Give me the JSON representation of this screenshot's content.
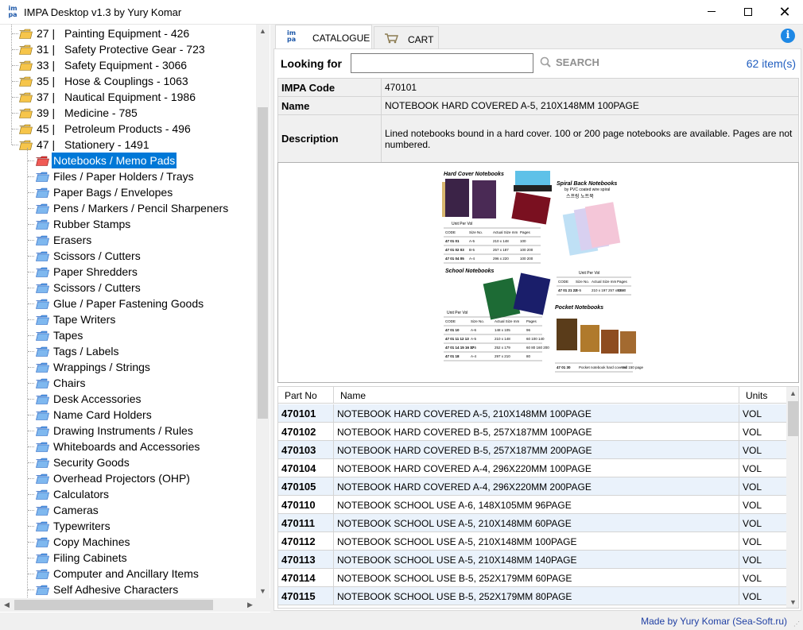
{
  "window": {
    "title": "IMPA Desktop v1.3 by Yury Komar",
    "app_icon_text": "im pa"
  },
  "tree": {
    "parents": [
      {
        "code": "27 |",
        "label": "Painting Equipment - 426"
      },
      {
        "code": "31 |",
        "label": "Safety Protective Gear - 723"
      },
      {
        "code": "33 |",
        "label": "Safety Equipment - 3066"
      },
      {
        "code": "35 |",
        "label": "Hose & Couplings - 1063"
      },
      {
        "code": "37 |",
        "label": "Nautical Equipment - 1986"
      },
      {
        "code": "39 |",
        "label": "Medicine - 785"
      },
      {
        "code": "45 |",
        "label": "Petroleum Products  - 496"
      },
      {
        "code": "47 |",
        "label": "Stationery - 1491"
      }
    ],
    "children": [
      {
        "label": "Notebooks / Memo Pads",
        "selected": true
      },
      {
        "label": "Files / Paper Holders / Trays"
      },
      {
        "label": "Paper Bags / Envelopes"
      },
      {
        "label": "Pens / Markers / Pencil Sharpeners"
      },
      {
        "label": "Rubber Stamps"
      },
      {
        "label": "Erasers"
      },
      {
        "label": "Scissors / Cutters"
      },
      {
        "label": "Paper Shredders"
      },
      {
        "label": "Scissors / Cutters"
      },
      {
        "label": "Glue / Paper Fastening Goods"
      },
      {
        "label": "Tape Writers"
      },
      {
        "label": "Tapes"
      },
      {
        "label": "Tags / Labels"
      },
      {
        "label": "Wrappings / Strings"
      },
      {
        "label": "Chairs"
      },
      {
        "label": "Desk Accessories"
      },
      {
        "label": "Name Card Holders"
      },
      {
        "label": "Drawing Instruments / Rules"
      },
      {
        "label": "Whiteboards and Accessories"
      },
      {
        "label": "Security Goods"
      },
      {
        "label": "Overhead Projectors (OHP)"
      },
      {
        "label": "Calculators"
      },
      {
        "label": "Cameras"
      },
      {
        "label": "Typewriters"
      },
      {
        "label": "Copy Machines"
      },
      {
        "label": "Filing Cabinets"
      },
      {
        "label": "Computer and Ancillary Items"
      },
      {
        "label": "Self Adhesive Characters"
      }
    ]
  },
  "tabs": {
    "catalogue": "CATALOGUE",
    "cart": "CART"
  },
  "search": {
    "label": "Looking for",
    "value": "",
    "button": "SEARCH",
    "count": "62 item(s)"
  },
  "details": {
    "code_label": "IMPA Code",
    "code_value": "470101",
    "name_label": "Name",
    "name_value": "NOTEBOOK HARD COVERED A-5, 210X148MM 100PAGE",
    "desc_label": "Description",
    "desc_value": "Lined notebooks bound in a hard cover. 100 or 200 page notebooks are available. Pages are not numbered."
  },
  "catalog_image": {
    "hard_cover_title": "Hard Cover Notebooks",
    "spiral_title": "Spiral Back Notebooks",
    "spiral_sub": "by PVC  coated wire spiral",
    "spiral_korean": "스프링 노트북",
    "school_title": "School Notebooks",
    "pocket_title": "Pocket Notebooks",
    "unit_per_vol": "Unit Per Vol",
    "hard_table": {
      "headers": [
        "CODE",
        "Size No.",
        "Actual Size mm",
        "Pages"
      ],
      "rows": [
        [
          "47 01 01",
          "A-5",
          "210 x 148",
          "100"
        ],
        [
          "47 01 02 03",
          "B-5",
          "257 x 187",
          "100 200"
        ],
        [
          "47 01 04 05",
          "A-4",
          "296 x 220",
          "100 200"
        ]
      ]
    },
    "spiral_table": {
      "headers": [
        "CODE",
        "Size No.",
        "Actual Size mm",
        "Pages"
      ],
      "rows": [
        [
          "47 01 21 22",
          "B-5",
          "210 x 197 257 x 182",
          "80 80"
        ]
      ]
    },
    "school_table": {
      "headers": [
        "CODE",
        "Size No.",
        "Actual Size mm",
        "Pages"
      ],
      "rows": [
        [
          "47 01 10",
          "A-6",
          "148 x 105",
          "96"
        ],
        [
          "47 01 11 12 13",
          "A-5",
          "210 x 148",
          "60 100 140"
        ],
        [
          "47 01 14 15 16 17",
          "B-5",
          "252 x 179",
          "60 80 160 200"
        ],
        [
          "47 01 18",
          "A-4",
          "297 x 210",
          "80"
        ]
      ]
    },
    "pocket_table": {
      "rows": [
        [
          "47 01 30",
          "Pocket notebook hard covered 150 page",
          "Vol"
        ]
      ]
    }
  },
  "grid": {
    "headers": {
      "part": "Part No",
      "name": "Name",
      "units": "Units"
    },
    "rows": [
      {
        "part": "470101",
        "name": "NOTEBOOK HARD COVERED A-5, 210X148MM 100PAGE",
        "units": "VOL"
      },
      {
        "part": "470102",
        "name": "NOTEBOOK HARD COVERED B-5, 257X187MM 100PAGE",
        "units": "VOL"
      },
      {
        "part": "470103",
        "name": "NOTEBOOK HARD COVERED B-5, 257X187MM 200PAGE",
        "units": "VOL"
      },
      {
        "part": "470104",
        "name": "NOTEBOOK HARD COVERED A-4, 296X220MM 100PAGE",
        "units": "VOL"
      },
      {
        "part": "470105",
        "name": "NOTEBOOK HARD COVERED A-4, 296X220MM 200PAGE",
        "units": "VOL"
      },
      {
        "part": "470110",
        "name": "NOTEBOOK SCHOOL USE A-6, 148X105MM 96PAGE",
        "units": "VOL"
      },
      {
        "part": "470111",
        "name": "NOTEBOOK SCHOOL USE A-5, 210X148MM 60PAGE",
        "units": "VOL"
      },
      {
        "part": "470112",
        "name": "NOTEBOOK SCHOOL USE A-5, 210X148MM 100PAGE",
        "units": "VOL"
      },
      {
        "part": "470113",
        "name": "NOTEBOOK SCHOOL USE A-5, 210X148MM 140PAGE",
        "units": "VOL"
      },
      {
        "part": "470114",
        "name": "NOTEBOOK SCHOOL USE B-5, 252X179MM 60PAGE",
        "units": "VOL"
      },
      {
        "part": "470115",
        "name": "NOTEBOOK SCHOOL USE B-5, 252X179MM 80PAGE",
        "units": "VOL"
      }
    ]
  },
  "status": {
    "credit": "Made by Yury Komar (Sea-Soft.ru)"
  },
  "colors": {
    "selection": "#0078d7",
    "folder_yellow": "#f6c54a",
    "folder_blue": "#3e8fdc",
    "folder_red": "#e53935",
    "link_blue": "#1f5dbf",
    "row_alt": "#eaf2fb"
  }
}
